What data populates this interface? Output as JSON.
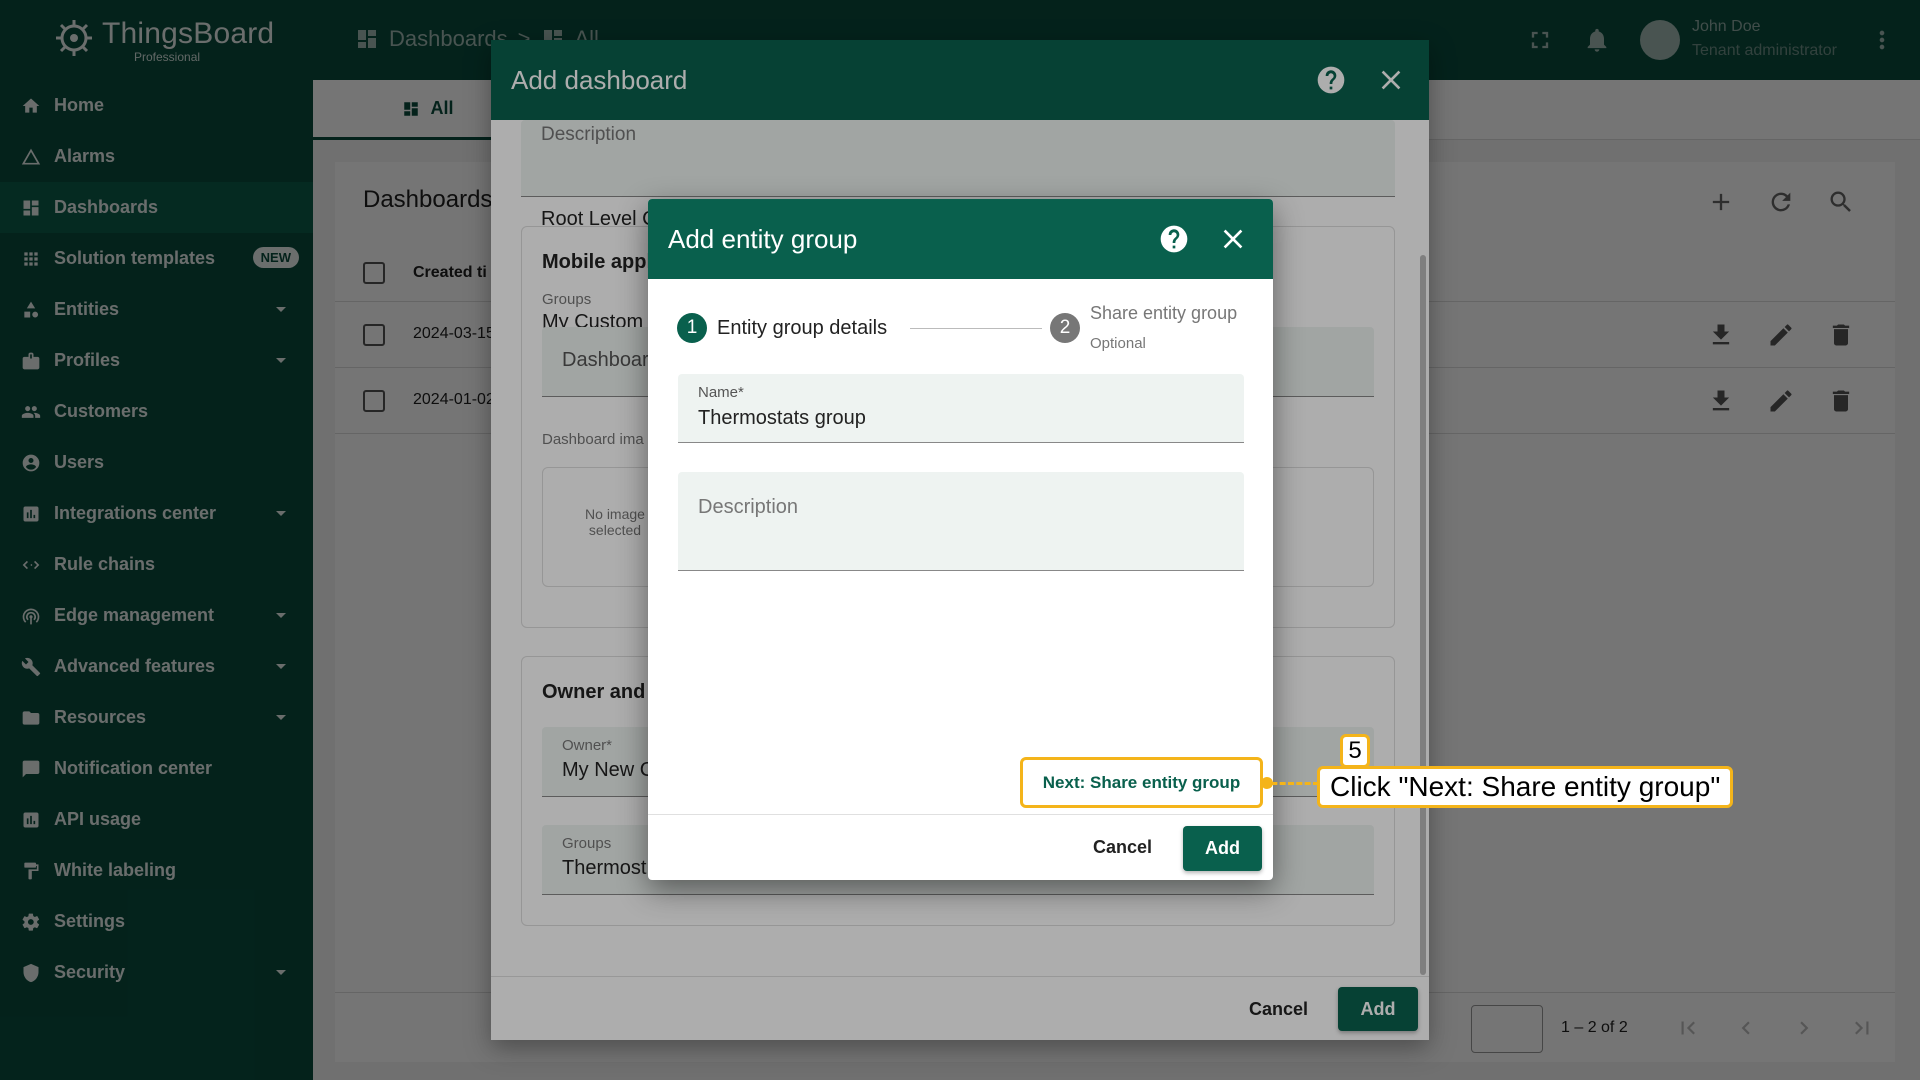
{
  "app": {
    "logo_text": "ThingsBoard",
    "logo_sub": "Professional"
  },
  "sidebar": {
    "items": [
      {
        "label": "Home",
        "icon": "home-icon"
      },
      {
        "label": "Alarms",
        "icon": "alarm-icon"
      },
      {
        "label": "Dashboards",
        "icon": "dashboard-icon",
        "active": true
      },
      {
        "label": "Solution templates",
        "icon": "apps-icon",
        "badge": "NEW"
      },
      {
        "label": "Entities",
        "icon": "entities-icon",
        "expandable": true
      },
      {
        "label": "Profiles",
        "icon": "profiles-icon",
        "expandable": true
      },
      {
        "label": "Customers",
        "icon": "customers-icon"
      },
      {
        "label": "Users",
        "icon": "users-icon"
      },
      {
        "label": "Integrations center",
        "icon": "integrations-icon",
        "expandable": true
      },
      {
        "label": "Rule chains",
        "icon": "rule-chains-icon"
      },
      {
        "label": "Edge management",
        "icon": "edge-icon",
        "expandable": true
      },
      {
        "label": "Advanced features",
        "icon": "tools-icon",
        "expandable": true
      },
      {
        "label": "Resources",
        "icon": "folder-icon",
        "expandable": true
      },
      {
        "label": "Notification center",
        "icon": "notification-icon"
      },
      {
        "label": "API usage",
        "icon": "chart-icon"
      },
      {
        "label": "White labeling",
        "icon": "paint-icon"
      },
      {
        "label": "Settings",
        "icon": "gear-icon"
      },
      {
        "label": "Security",
        "icon": "shield-icon",
        "expandable": true
      }
    ]
  },
  "topbar": {
    "breadcrumb_1": "Dashboards",
    "breadcrumb_sep": ">",
    "breadcrumb_2": "All",
    "user_name": "John Doe",
    "user_role": "Tenant administrator"
  },
  "main": {
    "tab_all": "All",
    "card_title": "Dashboards",
    "col_created": "Created ti",
    "rows": [
      {
        "created": "2024-03-15"
      },
      {
        "created": "2024-01-02"
      }
    ],
    "pager_text": "1 – 2 of 2"
  },
  "dialog_add_dashboard": {
    "title": "Add dashboard",
    "description_label": "Description",
    "root_level": "Root Level C",
    "mobile_app_title": "Mobile appl",
    "groups_label": "Groups",
    "groups_value": "My Custom",
    "dashboard_field": "Dashboar",
    "dashboard_image_label": "Dashboard ima",
    "no_image": "No image selected",
    "owner_section": "Owner and g",
    "owner_label": "Owner*",
    "owner_value": "My New C",
    "groups2_label": "Groups",
    "groups2_value": "Thermost",
    "cancel": "Cancel",
    "add": "Add"
  },
  "dialog_add_entity_group": {
    "title": "Add entity group",
    "step1_num": "1",
    "step1_label": "Entity group details",
    "step2_num": "2",
    "step2_label": "Share entity group",
    "step2_sub": "Optional",
    "name_label": "Name*",
    "name_value": "Thermostats group",
    "description_label": "Description",
    "next_button": "Next: Share entity group",
    "cancel": "Cancel",
    "add": "Add"
  },
  "callout": {
    "number": "5",
    "text": "Click \"Next: Share entity group\""
  },
  "colors": {
    "primary": "#09604d",
    "sidebar": "#094c3d",
    "callout": "#f4b41a"
  }
}
